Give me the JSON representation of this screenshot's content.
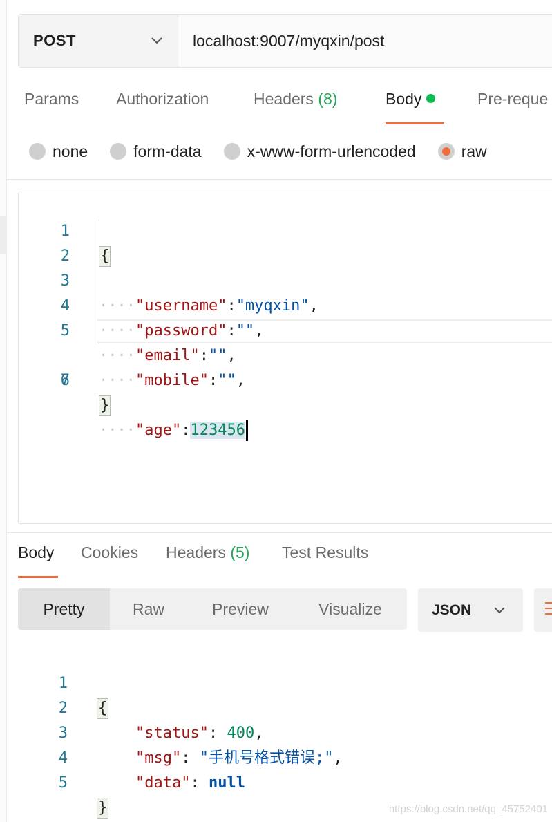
{
  "request": {
    "method": "POST",
    "url": "localhost:9007/myqxin/post"
  },
  "request_tabs": [
    {
      "label": "Params",
      "count": ""
    },
    {
      "label": "Authorization",
      "count": ""
    },
    {
      "label": "Headers",
      "count": "(8)"
    },
    {
      "label": "Body",
      "count": ""
    },
    {
      "label": "Pre-reque",
      "count": ""
    }
  ],
  "active_request_tab": "Body",
  "body_types": [
    "none",
    "form-data",
    "x-www-form-urlencoded",
    "raw"
  ],
  "selected_body_type": "raw",
  "request_body": {
    "line_numbers": [
      "1",
      "2",
      "3",
      "4",
      "5",
      "6",
      "7"
    ],
    "open_brace": "{",
    "close_brace": "}",
    "indent_dots": "····",
    "fields": [
      {
        "key": "\"username\"",
        "value": "\"myqxin\"",
        "tail": ","
      },
      {
        "key": "\"password\"",
        "value": "\"\"",
        "tail": ","
      },
      {
        "key": "\"email\"",
        "value": "\"\"",
        "tail": ","
      },
      {
        "key": "\"mobile\"",
        "value": "\"\"",
        "tail": ","
      },
      {
        "key": "\"age\"",
        "value": "123456",
        "tail": ""
      }
    ]
  },
  "response_tabs": [
    {
      "label": "Body",
      "count": ""
    },
    {
      "label": "Cookies",
      "count": ""
    },
    {
      "label": "Headers",
      "count": "(5)"
    },
    {
      "label": "Test Results",
      "count": ""
    }
  ],
  "active_response_tab": "Body",
  "view_modes": [
    "Pretty",
    "Raw",
    "Preview",
    "Visualize"
  ],
  "active_view_mode": "Pretty",
  "language": "JSON",
  "response_body": {
    "line_numbers": [
      "1",
      "2",
      "3",
      "4",
      "5"
    ],
    "open_brace": "{",
    "close_brace": "}",
    "fields": [
      {
        "key": "\"status\"",
        "value": "400",
        "tail": ","
      },
      {
        "key": "\"msg\"",
        "value": "\"手机号格式错误;\"",
        "tail": ","
      },
      {
        "key": "\"data\"",
        "value": "null",
        "tail": ""
      }
    ]
  },
  "watermark": "https://blog.csdn.net/qq_45752401",
  "colors": {
    "accent": "#f26b3a",
    "success_dot": "#0cbb52",
    "count_green": "#26a65b",
    "json_key": "#a31515",
    "json_string": "#0451a5",
    "json_number": "#098658"
  }
}
